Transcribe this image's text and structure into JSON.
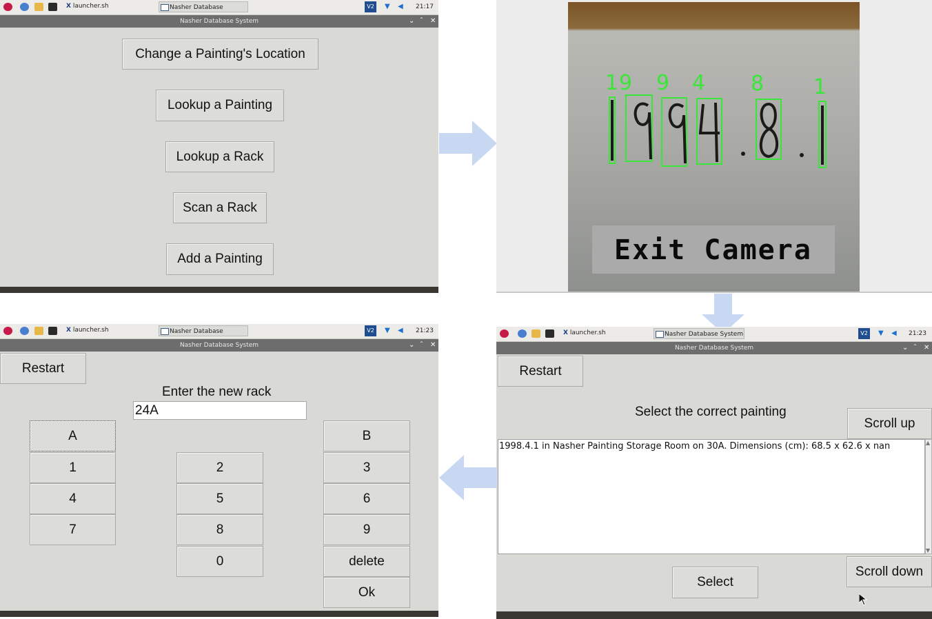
{
  "taskbar": {
    "launcher": "launcher.sh",
    "task": "Nasher Database System",
    "vnc": "V2",
    "times": [
      "21:17",
      "21:23",
      "21:23"
    ]
  },
  "window": {
    "title": "Nasher Database System"
  },
  "panel1": {
    "buttons": [
      "Change a Painting's Location",
      "Lookup a Painting",
      "Lookup a Rack",
      "Scan a Rack",
      "Add a Painting"
    ]
  },
  "panel2": {
    "digits": [
      "1",
      "9",
      "9",
      "4",
      "8",
      "1"
    ],
    "handwritten": "1994.8.1",
    "exit_label": "Exit Camera"
  },
  "panel3": {
    "restart": "Restart",
    "prompt": "Select the correct painting",
    "scroll_up": "Scroll up",
    "scroll_down": "Scroll down",
    "result_line": "1998.4.1 in Nasher Painting Storage Room on 30A. Dimensions (cm): 68.5 x 62.6 x nan",
    "select": "Select"
  },
  "panel4": {
    "restart": "Restart",
    "prompt": "Enter the new rack",
    "input_value": "24A",
    "keys": {
      "A": "A",
      "B": "B",
      "k1": "1",
      "k2": "2",
      "k3": "3",
      "k4": "4",
      "k5": "5",
      "k6": "6",
      "k7": "7",
      "k8": "8",
      "k9": "9",
      "k0": "0",
      "delete": "delete",
      "ok": "Ok"
    }
  },
  "colors": {
    "arrow": "#c9d8f2",
    "detect_green": "#39e639",
    "titlebar": "#6d6d6d",
    "window_bg": "#d9d9d6"
  }
}
